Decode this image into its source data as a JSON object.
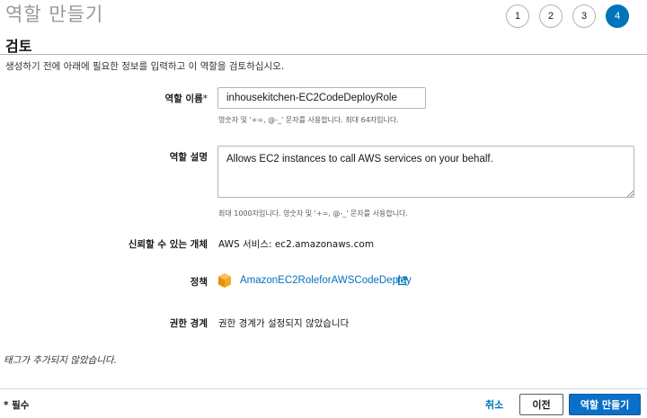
{
  "header": {
    "title": "역할 만들기"
  },
  "steps": [
    "1",
    "2",
    "3",
    "4"
  ],
  "active_step": "4",
  "section": {
    "title": "검토",
    "subtitle": "생성하기 전에 아래에 필요한 정보를 입력하고 이 역할을 검토하십시오."
  },
  "form": {
    "role_name": {
      "label": "역할 이름",
      "required_mark": "*",
      "value": "inhousekitchen-EC2CodeDeployRole",
      "hint": "영숫자 및 '+=, @-_' 문자를 사용합니다. 최대 64자입니다."
    },
    "role_description": {
      "label": "역할 설명",
      "value": "Allows EC2 instances to call AWS services on your behalf.",
      "hint": "최대 1000자입니다. 영숫자 및 '+=, @-_' 문자를 사용합니다."
    },
    "trusted_entity": {
      "label": "신뢰할 수 있는 개체",
      "value": "AWS 서비스: ec2.amazonaws.com"
    },
    "policies": {
      "label": "정책",
      "icon": "aws-policy-cube-icon",
      "policy_name": "AmazonEC2RoleforAWSCodeDeploy"
    },
    "permissions_boundary": {
      "label": "권한 경계",
      "value": "권한 경계가 설정되지 않았습니다"
    }
  },
  "tags_note": "태그가 추가되지 않았습니다.",
  "footer": {
    "required_note": "* 필수",
    "cancel": "취소",
    "previous": "이전",
    "create": "역할 만들기"
  },
  "colors": {
    "accent": "#0073bb",
    "primary_button": "#0a6fc7",
    "policy_icon": "#f5a623"
  }
}
